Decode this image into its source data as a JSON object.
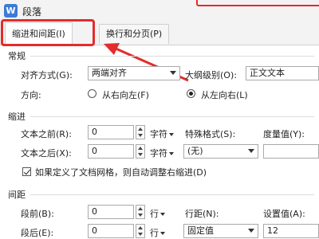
{
  "window": {
    "title": "段落",
    "logo_glyph": "W"
  },
  "tabs": [
    {
      "label": "缩进和间距(I)",
      "active": true
    },
    {
      "label": "换行和分页(P)",
      "active": false
    }
  ],
  "highlight_color": "#e42c2c",
  "general": {
    "heading": "常规",
    "alignment_label": "对齐方式(G):",
    "alignment_value": "两端对齐",
    "outline_label": "大纲级别(O):",
    "outline_value": "正文文本",
    "direction_label": "方向:",
    "rtl_label": "从右向左(F)",
    "ltr_label": "从左向右(L)",
    "direction_selected": "ltr"
  },
  "indent": {
    "heading": "缩进",
    "before_label": "文本之前(R):",
    "before_value": "0",
    "before_unit": "字符",
    "after_label": "文本之后(X):",
    "after_value": "0",
    "after_unit": "字符",
    "special_label": "特殊格式(S):",
    "special_value": "(无)",
    "measure_label": "度量值(Y):",
    "measure_value": "",
    "grid_checkbox_label": "如果定义了文档网格，则自动调整右缩进(D)",
    "grid_checkbox_checked": true
  },
  "spacing": {
    "heading": "间距",
    "before_label": "段前(B):",
    "before_value": "0",
    "before_unit": "行",
    "after_label": "段后(E):",
    "after_value": "0",
    "after_unit": "行",
    "line_label": "行距(N):",
    "line_value": "固定值",
    "setting_label": "设置值(A):",
    "setting_value": "12"
  }
}
